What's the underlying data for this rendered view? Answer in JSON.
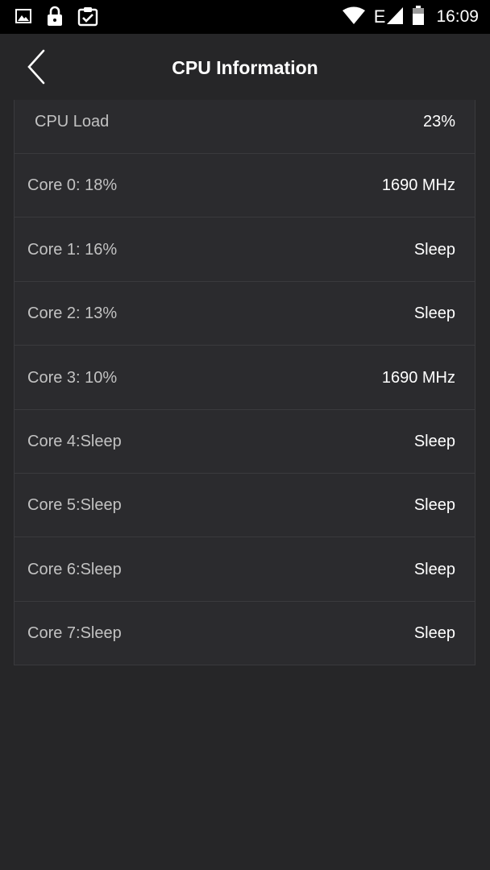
{
  "status_bar": {
    "left_icons": [
      "image-icon",
      "lock-icon",
      "clipboard-check-icon"
    ],
    "right_icons": [
      "wifi-icon",
      "signal-icon",
      "battery-icon"
    ],
    "network_type": "E",
    "time": "16:09"
  },
  "header": {
    "back_icon": "chevron-left-icon",
    "title": "CPU Information"
  },
  "cpu_load": {
    "label": "CPU Load",
    "value": "23%"
  },
  "cores": [
    {
      "label": "Core 0: 18%",
      "value": "1690 MHz"
    },
    {
      "label": "Core 1: 16%",
      "value": "Sleep"
    },
    {
      "label": "Core 2: 13%",
      "value": "Sleep"
    },
    {
      "label": "Core 3: 10%",
      "value": "1690 MHz"
    },
    {
      "label": "Core 4:Sleep",
      "value": "Sleep"
    },
    {
      "label": "Core 5:Sleep",
      "value": "Sleep"
    },
    {
      "label": "Core 6:Sleep",
      "value": "Sleep"
    },
    {
      "label": "Core 7:Sleep",
      "value": "Sleep"
    }
  ],
  "colors": {
    "background": "#262628",
    "status_bar": "#000000",
    "list_background": "#2b2b2e",
    "divider": "#3a3a3d",
    "label_text": "#c2c2c2",
    "value_text": "#ffffff"
  }
}
